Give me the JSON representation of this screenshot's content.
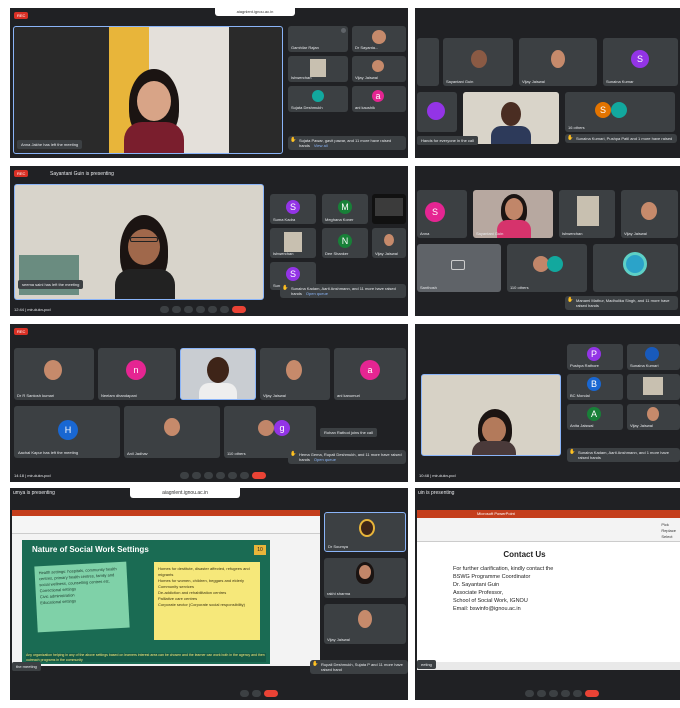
{
  "colors": {
    "meet_bg": "#202124",
    "tile_bg": "#3c4043",
    "end_call": "#ea4335",
    "rec": "#d93025",
    "accent": "#8ab4f8"
  },
  "url_bar": "aiagnlent.ignou.ac.in",
  "rec_label": "REC",
  "p1": {
    "toast": "Anna Jakhe has left the meeting",
    "tiles": [
      "Gamhilar Rajan",
      "Dr Sayanta...",
      "Ishwerchan",
      "Vijay Jaiswal",
      "Sujata Deshmukh",
      "ani kaushik"
    ],
    "hand": "Sujata Pawar, gavit pawar, and 11 more have raised hands",
    "view_all": "View all"
  },
  "p2": {
    "tiles": [
      "Sayantani Guin",
      "Vijay Jaiswal",
      "Sunaina Kumar"
    ],
    "others": "16 others",
    "hand": "Sunaina Kumari, Pushpa Patil and 1 more have raised",
    "toast": "Hands for everyone in the call"
  },
  "p3": {
    "presenting": "Sayantani Guin is presenting",
    "tiles": [
      "Suma Kadra",
      "Meghana Koner",
      "Ishwerchan",
      "Dee Shanker",
      "Vijay Jaiswal",
      "Sunaina Kumar"
    ],
    "toast": "seema saini has left the meeting",
    "hand": "Sunaina Kadam, Aarti Anshmann, and 11 more have raised hands",
    "view_all": "Open queue",
    "time": "12:44 | mir-dukn-pcd"
  },
  "p4": {
    "tiles": [
      "Anna",
      "Sayantani Guin",
      "Ishwerchan",
      "Vijay Jaiswal",
      "Santhosh"
    ],
    "others": "110 others",
    "hand": "Manami Mathur, Madhulika Singh, and 11 more have raised hands"
  },
  "p5": {
    "tiles": [
      "Dr R Santosh kumari",
      "Neelam dhandapani",
      "",
      "Vijay Jaiswal",
      "ani kanumuri",
      "Henna",
      "Anil Jadhav",
      "Rohan Rathod"
    ],
    "others": "110 others",
    "hand": "Hema Gema, Rupali Deshmukh, and 11 more have raised hands",
    "view_all": "Open queue",
    "toast": "Aachal Kapur has left the meeting",
    "join": "Rohan Rathod joins the call",
    "time": "14:18 | mir-dukn-pcd"
  },
  "p6": {
    "tiles": [
      "Pushpa Rathore",
      "Sunaina Kumari",
      "BC Mondal",
      "Anita Jaiswal",
      "Vijay Jaiswal"
    ],
    "hand": "Sunaina Kadam, Aarti Anshmann, and 1 more have raised hands",
    "time": "10:48 | mir-dukn-pcd"
  },
  "p7": {
    "presenting": "umya is presenting",
    "url": "aiagnlent.ignou.ac.in",
    "slide_title": "Nature of Social Work Settings",
    "slide_number": "10",
    "col1": [
      "Health settings: hospitals, community health centres, primary health centres, family and social wellness, counselling centres etc.",
      "Correctional settings",
      "Civic administration",
      "Educational settings"
    ],
    "col2": [
      "Homes for destitute, disaster affected, refugees and migrants",
      "Homes for women, children, beggars and elderly",
      "Community services",
      "De-addiction and rehabilitation centres",
      "Palliative care centres",
      "Corporate sector (Corporate social responsibility)"
    ],
    "footer_note": "Any organization helping in any of the above settings based on learners interest area can be chosen and the learner can work both in the agency and then outreach programs in the community",
    "tiles": [
      "Dr Soumya",
      "rakhi sharma",
      "Vijay Jaiswal"
    ],
    "hand": "Rupali Deshmukh, Sujata P and 11 more have raised hand",
    "toast": "the meeting"
  },
  "p8": {
    "presenting": "uin is presenting",
    "app": "Microsoft PowerPoint",
    "contact_title": "Contact Us",
    "contact_lines": [
      "For further clarification, kindly contact the",
      "BSWG Programme Coordinator",
      "Dr. Sayantani Guin",
      "Associate Professor,",
      "School of Social Work, IGNOU",
      "Email: bswinfo@ignou.ac.in"
    ],
    "toast": "eeting",
    "side_items": [
      "Pick",
      "Replace",
      "Select"
    ]
  }
}
